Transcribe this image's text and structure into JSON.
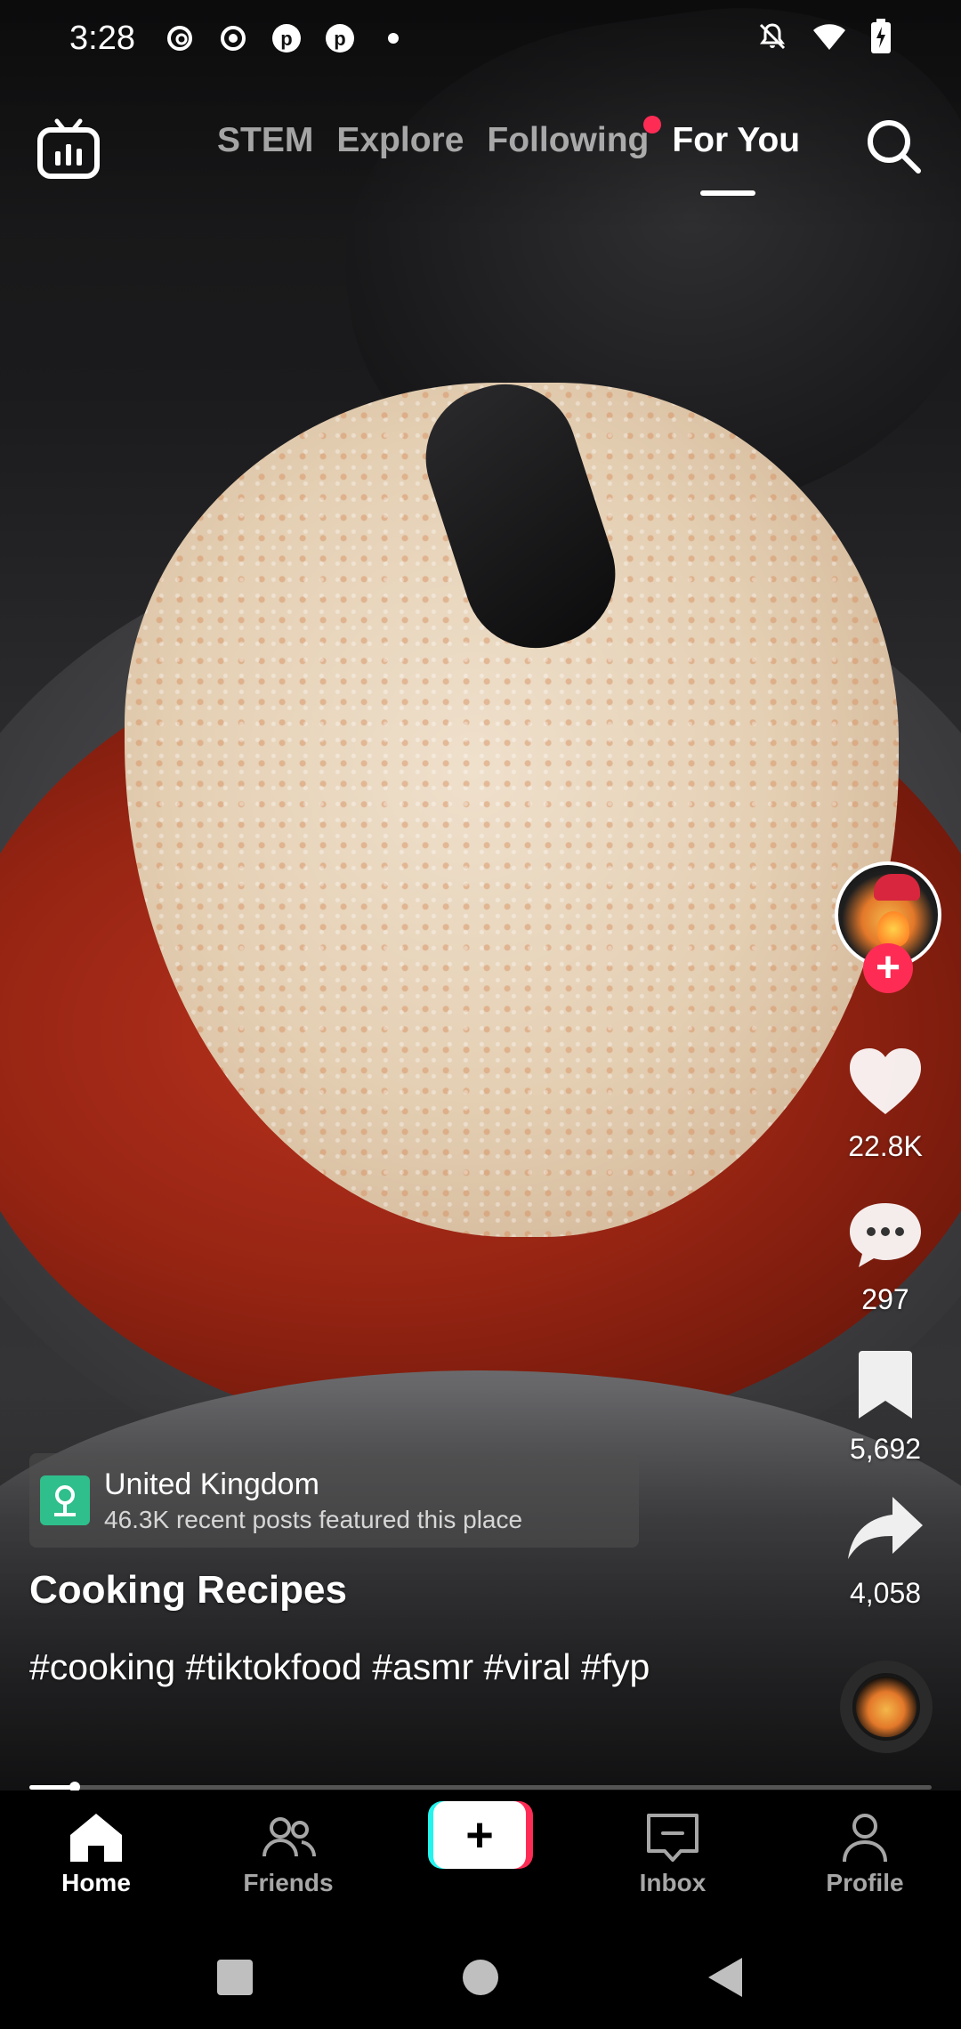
{
  "status_bar": {
    "time": "3:28",
    "left_icons": [
      "threads-icon",
      "record-icon",
      "pinterest-icon",
      "pinterest-icon",
      "dot-icon"
    ],
    "right_icons": [
      "mute-icon",
      "wifi-icon",
      "battery-charging-icon"
    ]
  },
  "top_nav": {
    "tabs": [
      {
        "label": "STEM",
        "active": false
      },
      {
        "label": "Explore",
        "active": false
      },
      {
        "label": "Following",
        "active": false,
        "has_notification_dot": true
      },
      {
        "label": "For You",
        "active": true
      }
    ]
  },
  "actions": {
    "likes": "22.8K",
    "comments": "297",
    "saves": "5,692",
    "shares": "4,058"
  },
  "location": {
    "title": "United Kingdom",
    "subtitle": "46.3K recent posts featured this place"
  },
  "post": {
    "author": "Cooking Recipes",
    "caption": "#cooking #tiktokfood #asmr #viral #fyp",
    "progress": 0.05
  },
  "bottom_nav": {
    "items": [
      {
        "label": "Home",
        "active": true
      },
      {
        "label": "Friends",
        "active": false
      },
      {
        "label": "Inbox",
        "active": false
      },
      {
        "label": "Profile",
        "active": false
      }
    ],
    "create_symbol": "+"
  },
  "colors": {
    "accent": "#fe2c55",
    "cyan": "#25f4ee",
    "location_icon": "#2fbf8c"
  }
}
